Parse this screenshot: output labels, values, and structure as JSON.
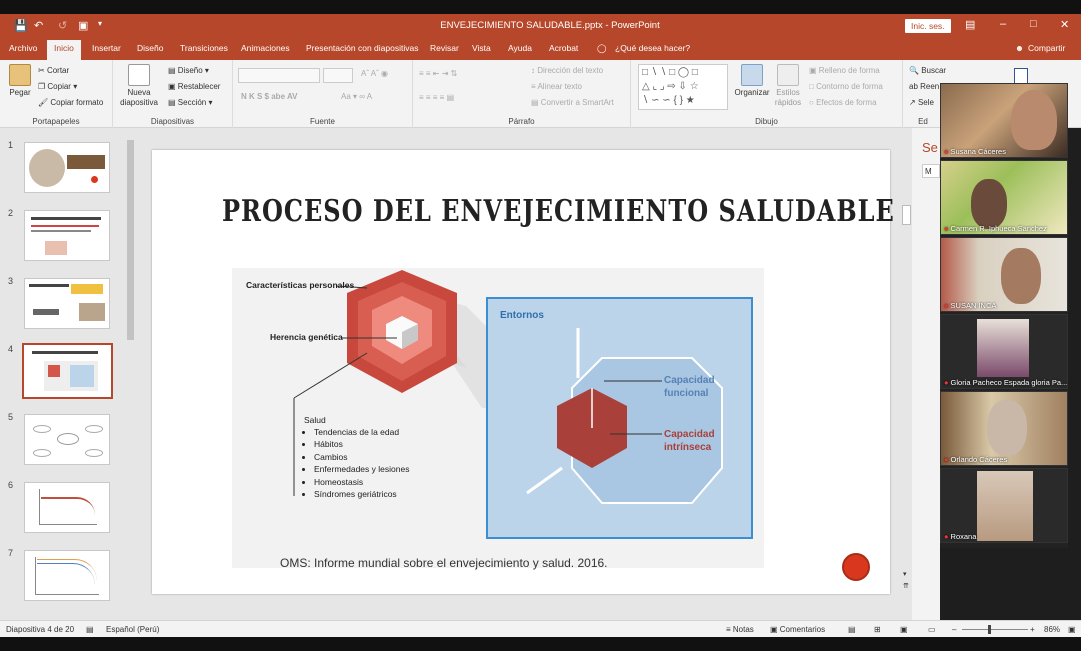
{
  "window": {
    "title": "ENVEJECIMIENTO SALUDABLE.pptx  -  PowerPoint",
    "signin": "Inic. ses.",
    "share": "Compartir"
  },
  "tabs": [
    "Archivo",
    "Inicio",
    "Insertar",
    "Diseño",
    "Transiciones",
    "Animaciones",
    "Presentación con diapositivas",
    "Revisar",
    "Vista",
    "Ayuda",
    "Acrobat",
    "¿Qué desea hacer?"
  ],
  "ribbon": {
    "paste": "Pegar",
    "cut": "Cortar",
    "copy": "Copiar",
    "format_painter": "Copiar formato",
    "clipboard_group": "Portapapeles",
    "new_slide": "Nueva diapositiva",
    "layout": "Diseño",
    "reset": "Restablecer",
    "section": "Sección",
    "slides_group": "Diapositivas",
    "font_group": "Fuente",
    "font_buttons": "N  K  S  $  abe  AV",
    "text_direction": "Dirección del texto",
    "align_text": "Alinear texto",
    "smartart": "Convertir a SmartArt",
    "paragraph_group": "Párrafo",
    "arrange": "Organizar",
    "quick_styles": "Estilos rápidos",
    "shape_fill": "Relleno de forma",
    "shape_outline": "Contorno de forma",
    "shape_effects": "Efectos de forma",
    "drawing_group": "Dibujo",
    "find": "Buscar",
    "replace": "Reen",
    "select": "Sele",
    "editing_group": "Ed"
  },
  "slides": [
    {
      "num": "1"
    },
    {
      "num": "2"
    },
    {
      "num": "3"
    },
    {
      "num": "4"
    },
    {
      "num": "5"
    },
    {
      "num": "6"
    },
    {
      "num": "7"
    }
  ],
  "slide": {
    "title": "PROCESO DEL ENVEJECIMIENTO SALUDABLE",
    "caracteristicas": "Características personales",
    "herencia": "Herencia genética",
    "entornos": "Entornos",
    "capacidad_funcional": "Capacidad funcional",
    "capacidad_intrinseca": "Capacidad intrínseca",
    "salud": "Salud",
    "salud_items": [
      "Tendencias de la edad",
      "Hábitos",
      "Cambios",
      "Enfermedades y lesiones",
      "Homeostasis",
      "Síndromes geriátricos"
    ],
    "cite": "OMS: Informe mundial sobre el envejecimiento y salud. 2016."
  },
  "rightpanel": {
    "label_se": "Se",
    "label_m": "M"
  },
  "participants": [
    {
      "name": "Susana Cáceres"
    },
    {
      "name": "Carmen R. Iphueca Sanchez"
    },
    {
      "name": "SUSAN INCA"
    },
    {
      "name": "Gloria Pacheco Espada gloria Pa..."
    },
    {
      "name": "Orlando Cáceres"
    },
    {
      "name": "Roxana"
    }
  ],
  "statusbar": {
    "slide_of": "Diapositiva 4 de 20",
    "language": "Español (Perú)",
    "notes": "Notas",
    "comments": "Comentarios",
    "zoom": "86%"
  },
  "colors": {
    "accent": "#b7472a",
    "ribbon_bg": "#f3f3f3",
    "hex_red": "#d4564a",
    "entornos_bg": "#bcd4ea"
  }
}
